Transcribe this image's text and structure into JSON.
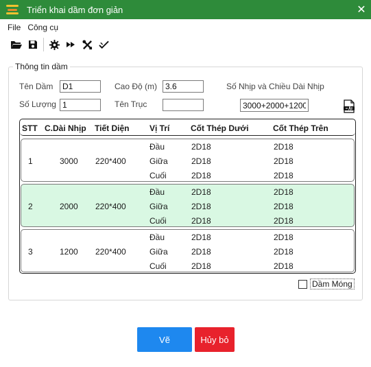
{
  "window": {
    "title": "Triển khai dầm đơn giản"
  },
  "menu": {
    "items": [
      "File",
      "Công cụ"
    ]
  },
  "group": {
    "title": "Thông tin dầm"
  },
  "form": {
    "ten_dam_label": "Tên Dầm",
    "ten_dam_value": "D1",
    "cao_do_label": "Cao Độ (m)",
    "cao_do_value": "3.6",
    "so_nhip_label": "Số Nhịp và Chiều Dài Nhịp",
    "so_nhip_value": "3000+2000+1200",
    "so_luong_label": "Số Lượng",
    "so_luong_value": "1",
    "ten_truc_label": "Tên Trục",
    "ten_truc_value": ""
  },
  "table": {
    "headers": [
      "STT",
      "C.Dài Nhịp",
      "Tiết Diện",
      "Vị Trí",
      "Cốt Thép Dưới",
      "Cốt Thép Trên"
    ],
    "rows": [
      {
        "stt": "1",
        "length": "3000",
        "section": "220*400",
        "selected": false,
        "positions": [
          "Đầu",
          "Giữa",
          "Cuối"
        ],
        "bottom": [
          "2D18",
          "2D18",
          "2D18"
        ],
        "top": [
          "2D18",
          "2D18",
          "2D18"
        ]
      },
      {
        "stt": "2",
        "length": "2000",
        "section": "220*400",
        "selected": true,
        "positions": [
          "Đầu",
          "Giữa",
          "Cuối"
        ],
        "bottom": [
          "2D18",
          "2D18",
          "2D18"
        ],
        "top": [
          "2D18",
          "2D18",
          "2D18"
        ]
      },
      {
        "stt": "3",
        "length": "1200",
        "section": "220*400",
        "selected": false,
        "positions": [
          "Đầu",
          "Giữa",
          "Cuối"
        ],
        "bottom": [
          "2D18",
          "2D18",
          "2D18"
        ],
        "top": [
          "2D18",
          "2D18",
          "2D18"
        ]
      }
    ]
  },
  "checkbox": {
    "label": "Dầm Móng",
    "checked": false
  },
  "buttons": {
    "draw": "Vẽ",
    "cancel": "Hủy bỏ"
  },
  "colors": {
    "titlebar": "#2e8b3a",
    "selected_row": "#d9f8e3",
    "draw_button": "#1e88ef",
    "cancel_button": "#e8222c"
  },
  "icons": {
    "toolbar": [
      "folder-open-icon",
      "save-icon",
      "gear-icon",
      "fast-forward-icon",
      "tools-icon",
      "check-icon"
    ],
    "cad": "cad-file-icon"
  }
}
